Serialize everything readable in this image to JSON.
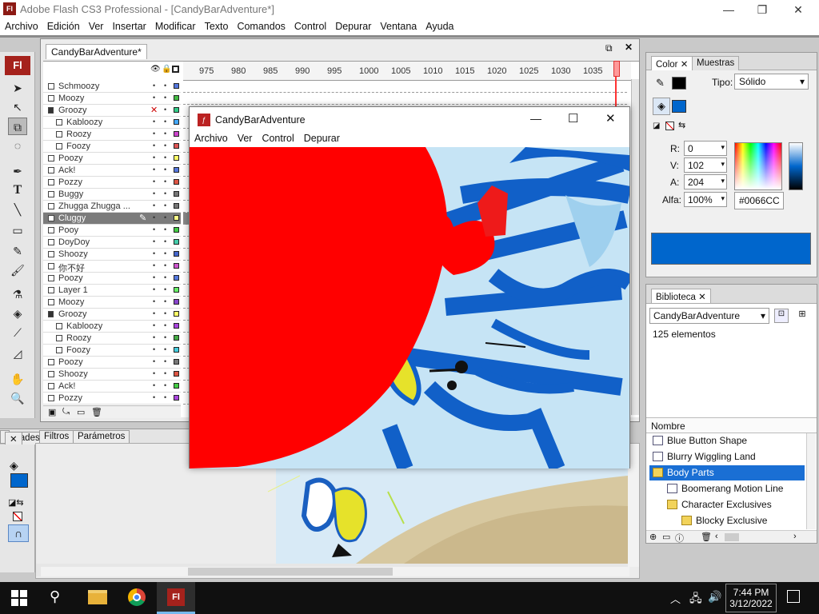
{
  "app": {
    "logo": "Fl",
    "title": "Adobe Flash CS3 Professional - [CandyBarAdventure*]",
    "min": "—",
    "max": "❐",
    "close": "✕"
  },
  "menu": [
    "Archivo",
    "Edición",
    "Ver",
    "Insertar",
    "Modificar",
    "Texto",
    "Comandos",
    "Control",
    "Depurar",
    "Ventana",
    "Ayuda"
  ],
  "tools": {
    "logo": "Fl"
  },
  "document": {
    "tab": "CandyBarAdventure*"
  },
  "ruler": [
    "975",
    "980",
    "985",
    "990",
    "995",
    "1000",
    "1005",
    "1010",
    "1015",
    "1020",
    "1025",
    "1030",
    "1035"
  ],
  "layers": [
    {
      "name": "Schmoozy",
      "indent": 0,
      "sq": "#5577dd"
    },
    {
      "name": "Moozy",
      "indent": 0,
      "sq": "#44bb44"
    },
    {
      "name": "Groozy",
      "indent": 0,
      "sq": "#33cc88",
      "folder": true,
      "x": true
    },
    {
      "name": "Kabloozy",
      "indent": 1,
      "sq": "#44aaff"
    },
    {
      "name": "Roozy",
      "indent": 1,
      "sq": "#cc44cc"
    },
    {
      "name": "Foozy",
      "indent": 1,
      "sq": "#dd5555"
    },
    {
      "name": "Poozy",
      "indent": 0,
      "sq": "#ffff66"
    },
    {
      "name": "Ack!",
      "indent": 0,
      "sq": "#5577dd"
    },
    {
      "name": "Pozzy",
      "indent": 0,
      "sq": "#dd5544"
    },
    {
      "name": "Buggy",
      "indent": 0,
      "sq": "#777777"
    },
    {
      "name": "Zhugga Zhugga ...",
      "indent": 0,
      "sq": "#777777"
    },
    {
      "name": "Cluggy",
      "indent": 0,
      "sq": "#ffff88",
      "sel": true
    },
    {
      "name": "Pooy",
      "indent": 0,
      "sq": "#44cc44"
    },
    {
      "name": "DoyDoy",
      "indent": 0,
      "sq": "#44ccaa"
    },
    {
      "name": "Shoozy",
      "indent": 0,
      "sq": "#4466cc"
    },
    {
      "name": "你不好",
      "indent": 0,
      "sq": "#cc55cc"
    },
    {
      "name": "Poozy",
      "indent": 0,
      "sq": "#5577dd"
    },
    {
      "name": "Layer 1",
      "indent": 0,
      "sq": "#66ee66"
    },
    {
      "name": "Moozy",
      "indent": 0,
      "sq": "#8844cc"
    },
    {
      "name": "Groozy",
      "indent": 0,
      "sq": "#ffff66",
      "folder": true
    },
    {
      "name": "Kabloozy",
      "indent": 1,
      "sq": "#aa44dd"
    },
    {
      "name": "Roozy",
      "indent": 1,
      "sq": "#44aa44"
    },
    {
      "name": "Foozy",
      "indent": 1,
      "sq": "#44ccdd"
    },
    {
      "name": "Poozy",
      "indent": 0,
      "sq": "#777777"
    },
    {
      "name": "Shoozy",
      "indent": 0,
      "sq": "#dd5544"
    },
    {
      "name": "Ack!",
      "indent": 0,
      "sq": "#44cc44"
    },
    {
      "name": "Pozzy",
      "indent": 0,
      "sq": "#aa44dd"
    }
  ],
  "swf": {
    "title": "CandyBarAdventure",
    "menu": [
      "Archivo",
      "Ver",
      "Control",
      "Depurar"
    ],
    "min": "—",
    "max": "☐",
    "close": "✕"
  },
  "props": {
    "tabs": [
      "edades",
      "Filtros",
      "Parámetros"
    ],
    "close": "✕"
  },
  "color_panel": {
    "tabs": [
      "Color",
      "Muestras"
    ],
    "close": "✕",
    "tipo_label": "Tipo:",
    "tipo_value": "Sólido",
    "r_label": "R:",
    "r": "0",
    "g_label": "V:",
    "g": "102",
    "b_label": "A:",
    "b": "204",
    "alpha_label": "Alfa:",
    "alpha": "100%",
    "hex": "#0066CC",
    "fill_color": "#0066CC"
  },
  "library": {
    "tab": "Biblioteca",
    "close": "✕",
    "doc": "CandyBarAdventure",
    "count": "125 elementos",
    "col_name": "Nombre",
    "items": [
      {
        "label": "Blue Button Shape",
        "type": "symbol",
        "indent": 0
      },
      {
        "label": "Blurry Wiggling Land",
        "type": "symbol",
        "indent": 0
      },
      {
        "label": "Body Parts",
        "type": "folder",
        "indent": 0,
        "sel": true
      },
      {
        "label": "Boomerang Motion Line",
        "type": "symbol",
        "indent": 1
      },
      {
        "label": "Character Exclusives",
        "type": "folder",
        "indent": 1
      },
      {
        "label": "Blocky Exclusive",
        "type": "folder",
        "indent": 2
      }
    ]
  },
  "taskbar": {
    "time": "7:44 PM",
    "date": "3/12/2022"
  }
}
